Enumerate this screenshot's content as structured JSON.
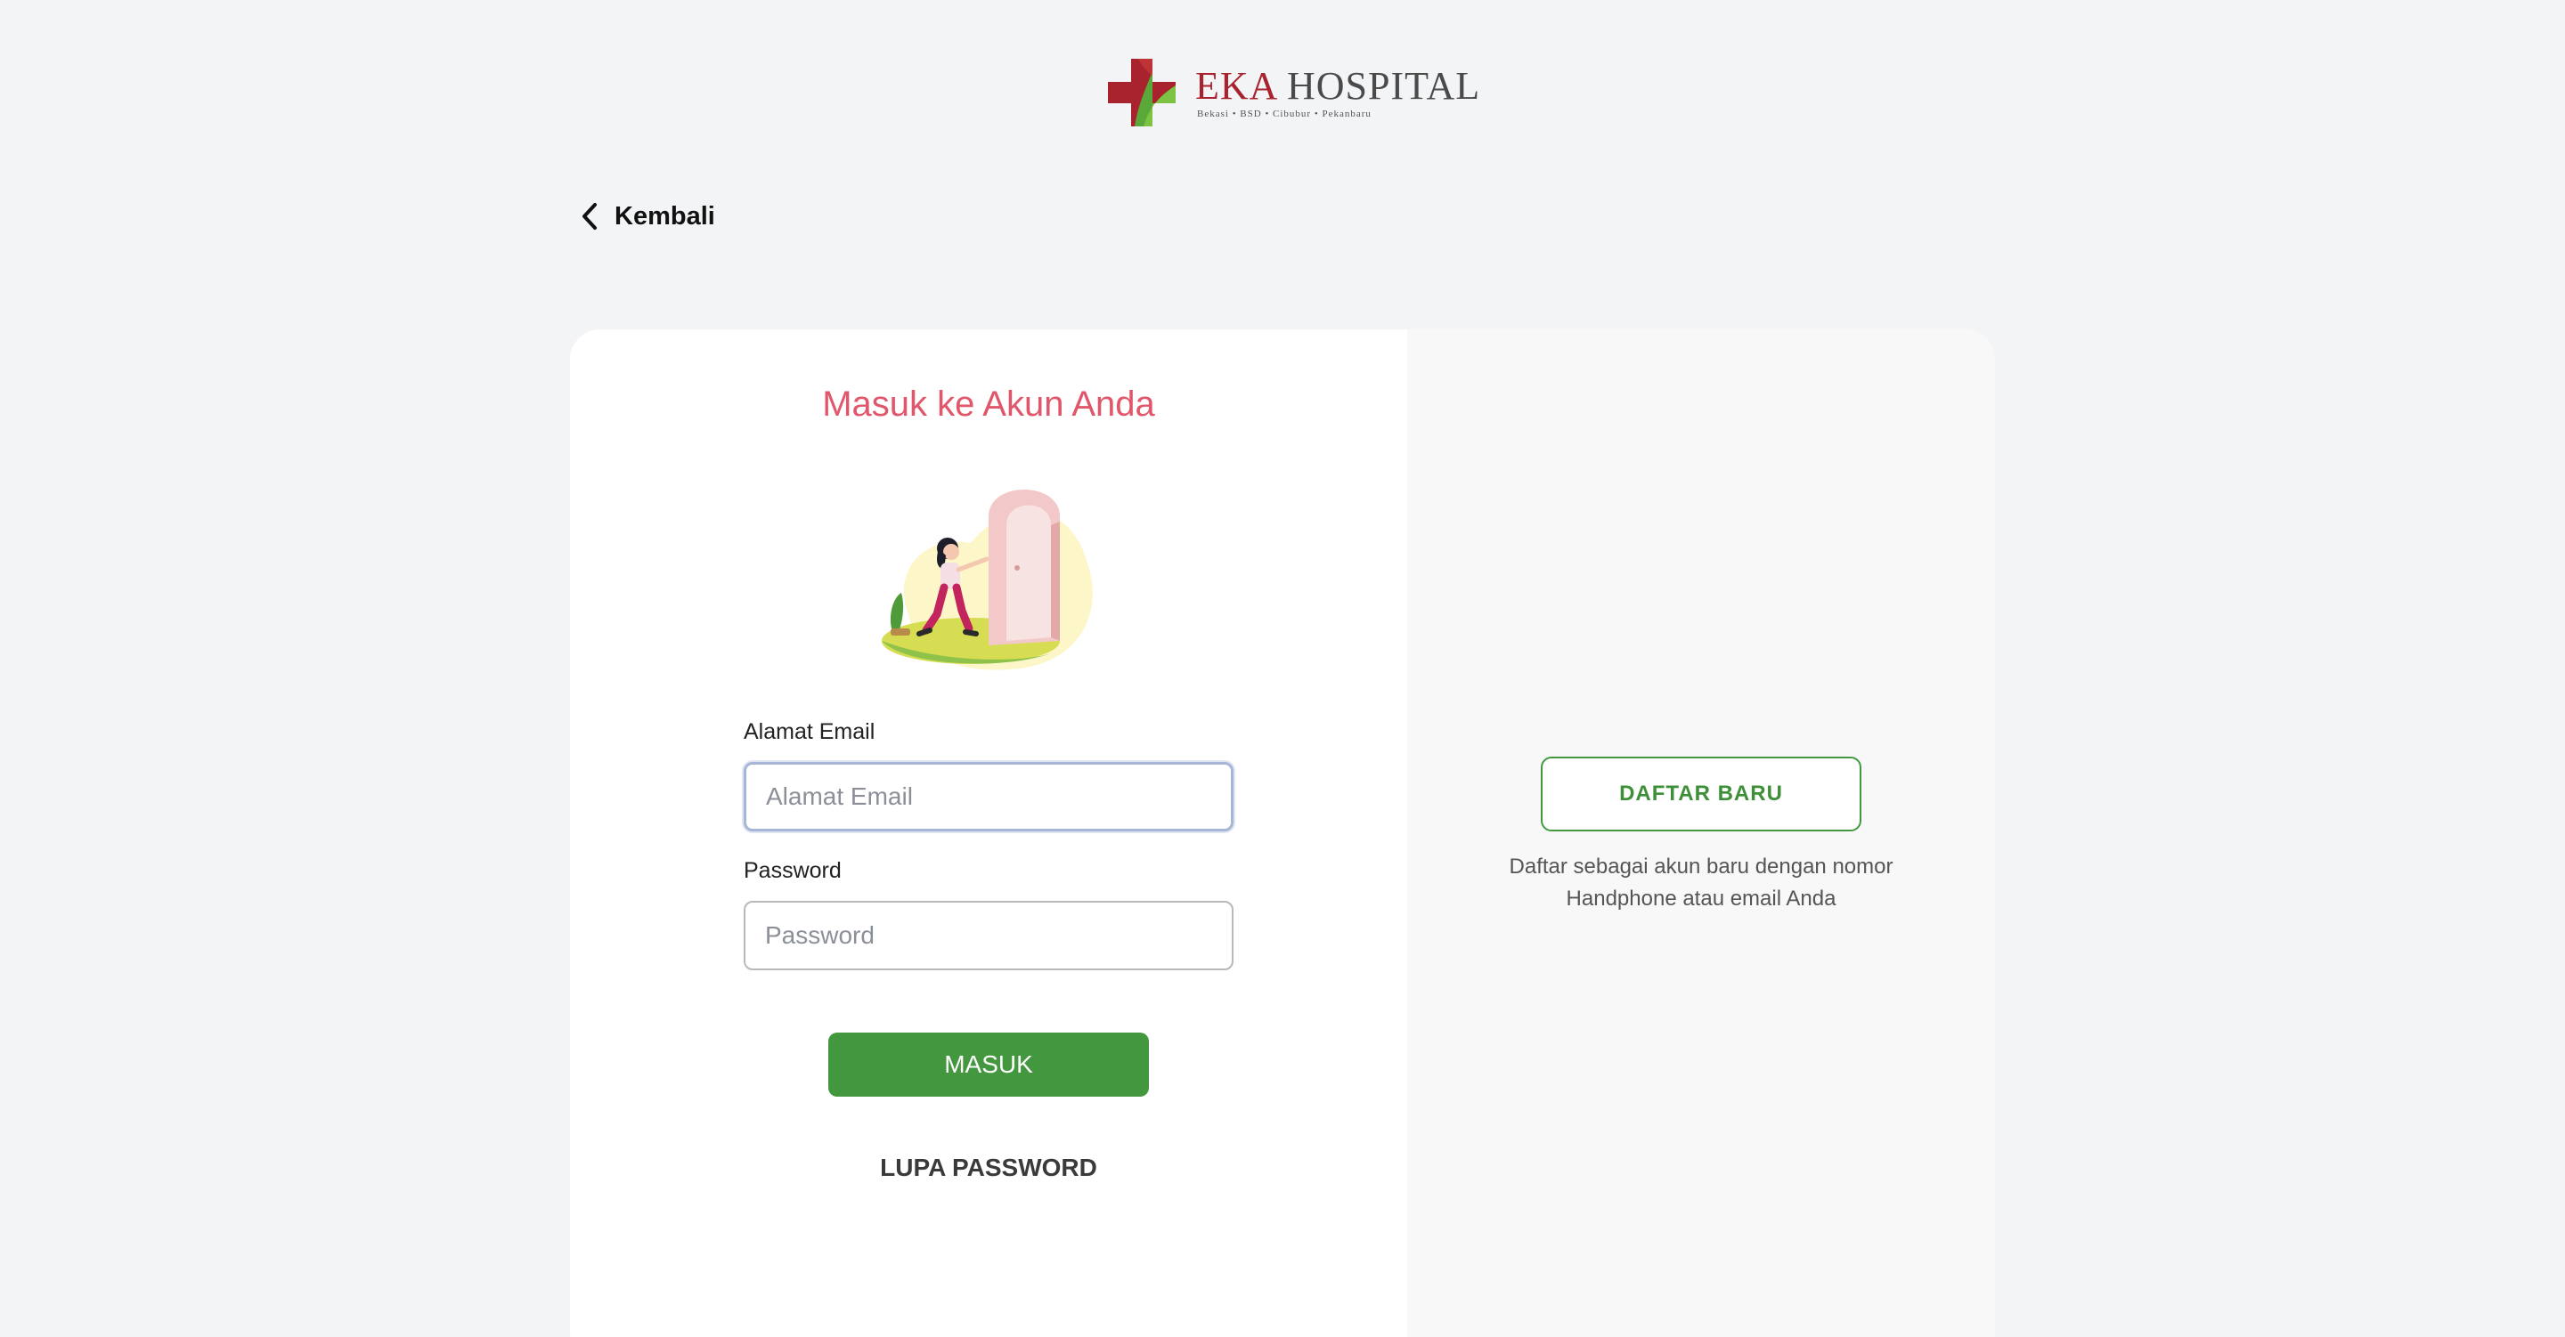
{
  "header": {
    "logo_name_primary": "EKA",
    "logo_name_secondary": "HOSPITAL",
    "logo_tagline": "Bekasi • BSD • Cibubur • Pekanbaru",
    "logo_colors": {
      "red": "#a8232d",
      "green": "#5aa83a"
    }
  },
  "nav": {
    "back_label": "Kembali",
    "back_icon": "chevron-left-icon"
  },
  "login": {
    "title": "Masuk ke Akun Anda",
    "illustration": "person-opening-door-illustration",
    "email_label": "Alamat Email",
    "email_placeholder": "Alamat Email",
    "email_value": "",
    "password_label": "Password",
    "password_placeholder": "Password",
    "password_value": "",
    "submit_label": "MASUK",
    "forgot_label": "LUPA PASSWORD"
  },
  "register": {
    "button_label": "DAFTAR BARU",
    "description": "Daftar sebagai akun baru dengan nomor Handphone atau email Anda"
  },
  "colors": {
    "background": "#f3f4f6",
    "title": "#e0566a",
    "primary_green": "#43973f",
    "right_panel": "#f8f8f8"
  }
}
